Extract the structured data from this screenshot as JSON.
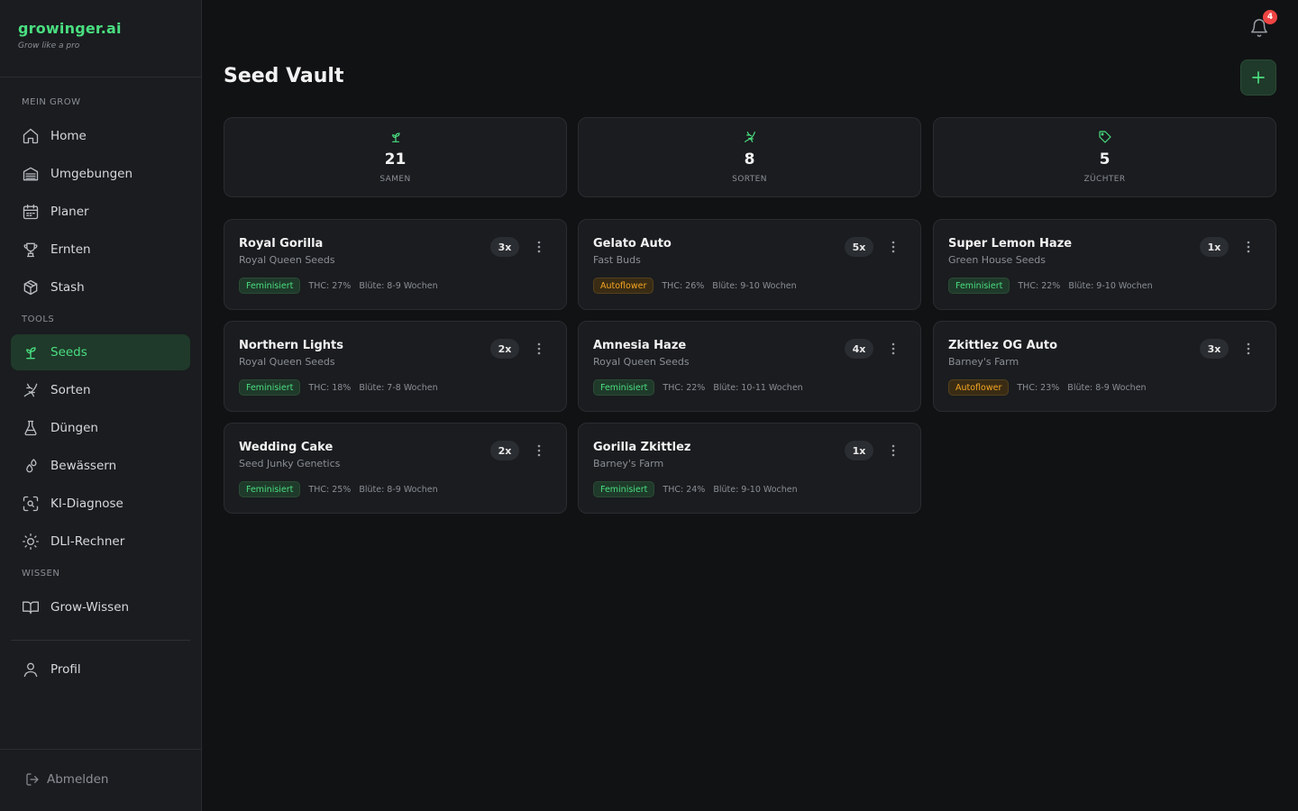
{
  "brand": {
    "name": "growinger.ai",
    "tagline": "Grow like a pro"
  },
  "sidebar": {
    "sections": {
      "grow": "MEIN GROW",
      "tools": "TOOLS",
      "wissen": "WISSEN"
    },
    "items": [
      {
        "label": "Home",
        "icon": "home-icon"
      },
      {
        "label": "Umgebungen",
        "icon": "tent-icon"
      },
      {
        "label": "Planer",
        "icon": "calendar-icon"
      },
      {
        "label": "Ernten",
        "icon": "trophy-icon"
      },
      {
        "label": "Stash",
        "icon": "box-icon"
      },
      {
        "label": "Seeds",
        "icon": "sprout-icon",
        "active": true
      },
      {
        "label": "Sorten",
        "icon": "dna-icon"
      },
      {
        "label": "Düngen",
        "icon": "flask-icon"
      },
      {
        "label": "Bewässern",
        "icon": "droplets-icon"
      },
      {
        "label": "KI-Diagnose",
        "icon": "scan-icon"
      },
      {
        "label": "DLI-Rechner",
        "icon": "sun-icon"
      },
      {
        "label": "Grow-Wissen",
        "icon": "book-icon"
      },
      {
        "label": "Profil",
        "icon": "user-icon"
      }
    ],
    "logout": "Abmelden"
  },
  "header": {
    "notifications": "4"
  },
  "page": {
    "title": "Seed Vault"
  },
  "stats": [
    {
      "value": "21",
      "label": "SAMEN",
      "icon": "sprout-icon"
    },
    {
      "value": "8",
      "label": "SORTEN",
      "icon": "dna-icon"
    },
    {
      "value": "5",
      "label": "ZÜCHTER",
      "icon": "tag-icon"
    }
  ],
  "seeds": [
    {
      "name": "Royal Gorilla",
      "breeder": "Royal Queen Seeds",
      "qty": "3x",
      "type": "Feminisiert",
      "thc": "THC: 27%",
      "bloom": "Blüte: 8-9 Wochen"
    },
    {
      "name": "Gelato Auto",
      "breeder": "Fast Buds",
      "qty": "5x",
      "type": "Autoflower",
      "thc": "THC: 26%",
      "bloom": "Blüte: 9-10 Wochen"
    },
    {
      "name": "Super Lemon Haze",
      "breeder": "Green House Seeds",
      "qty": "1x",
      "type": "Feminisiert",
      "thc": "THC: 22%",
      "bloom": "Blüte: 9-10 Wochen"
    },
    {
      "name": "Northern Lights",
      "breeder": "Royal Queen Seeds",
      "qty": "2x",
      "type": "Feminisiert",
      "thc": "THC: 18%",
      "bloom": "Blüte: 7-8 Wochen"
    },
    {
      "name": "Amnesia Haze",
      "breeder": "Royal Queen Seeds",
      "qty": "4x",
      "type": "Feminisiert",
      "thc": "THC: 22%",
      "bloom": "Blüte: 10-11 Wochen"
    },
    {
      "name": "Zkittlez OG Auto",
      "breeder": "Barney's Farm",
      "qty": "3x",
      "type": "Autoflower",
      "thc": "THC: 23%",
      "bloom": "Blüte: 8-9 Wochen"
    },
    {
      "name": "Wedding Cake",
      "breeder": "Seed Junky Genetics",
      "qty": "2x",
      "type": "Feminisiert",
      "thc": "THC: 25%",
      "bloom": "Blüte: 8-9 Wochen"
    },
    {
      "name": "Gorilla Zkittlez",
      "breeder": "Barney's Farm",
      "qty": "1x",
      "type": "Feminisiert",
      "thc": "THC: 24%",
      "bloom": "Blüte: 9-10 Wochen"
    }
  ],
  "colors": {
    "accent": "#4ade80",
    "autoflower": "#f5a623",
    "badge": "#ef4444"
  }
}
